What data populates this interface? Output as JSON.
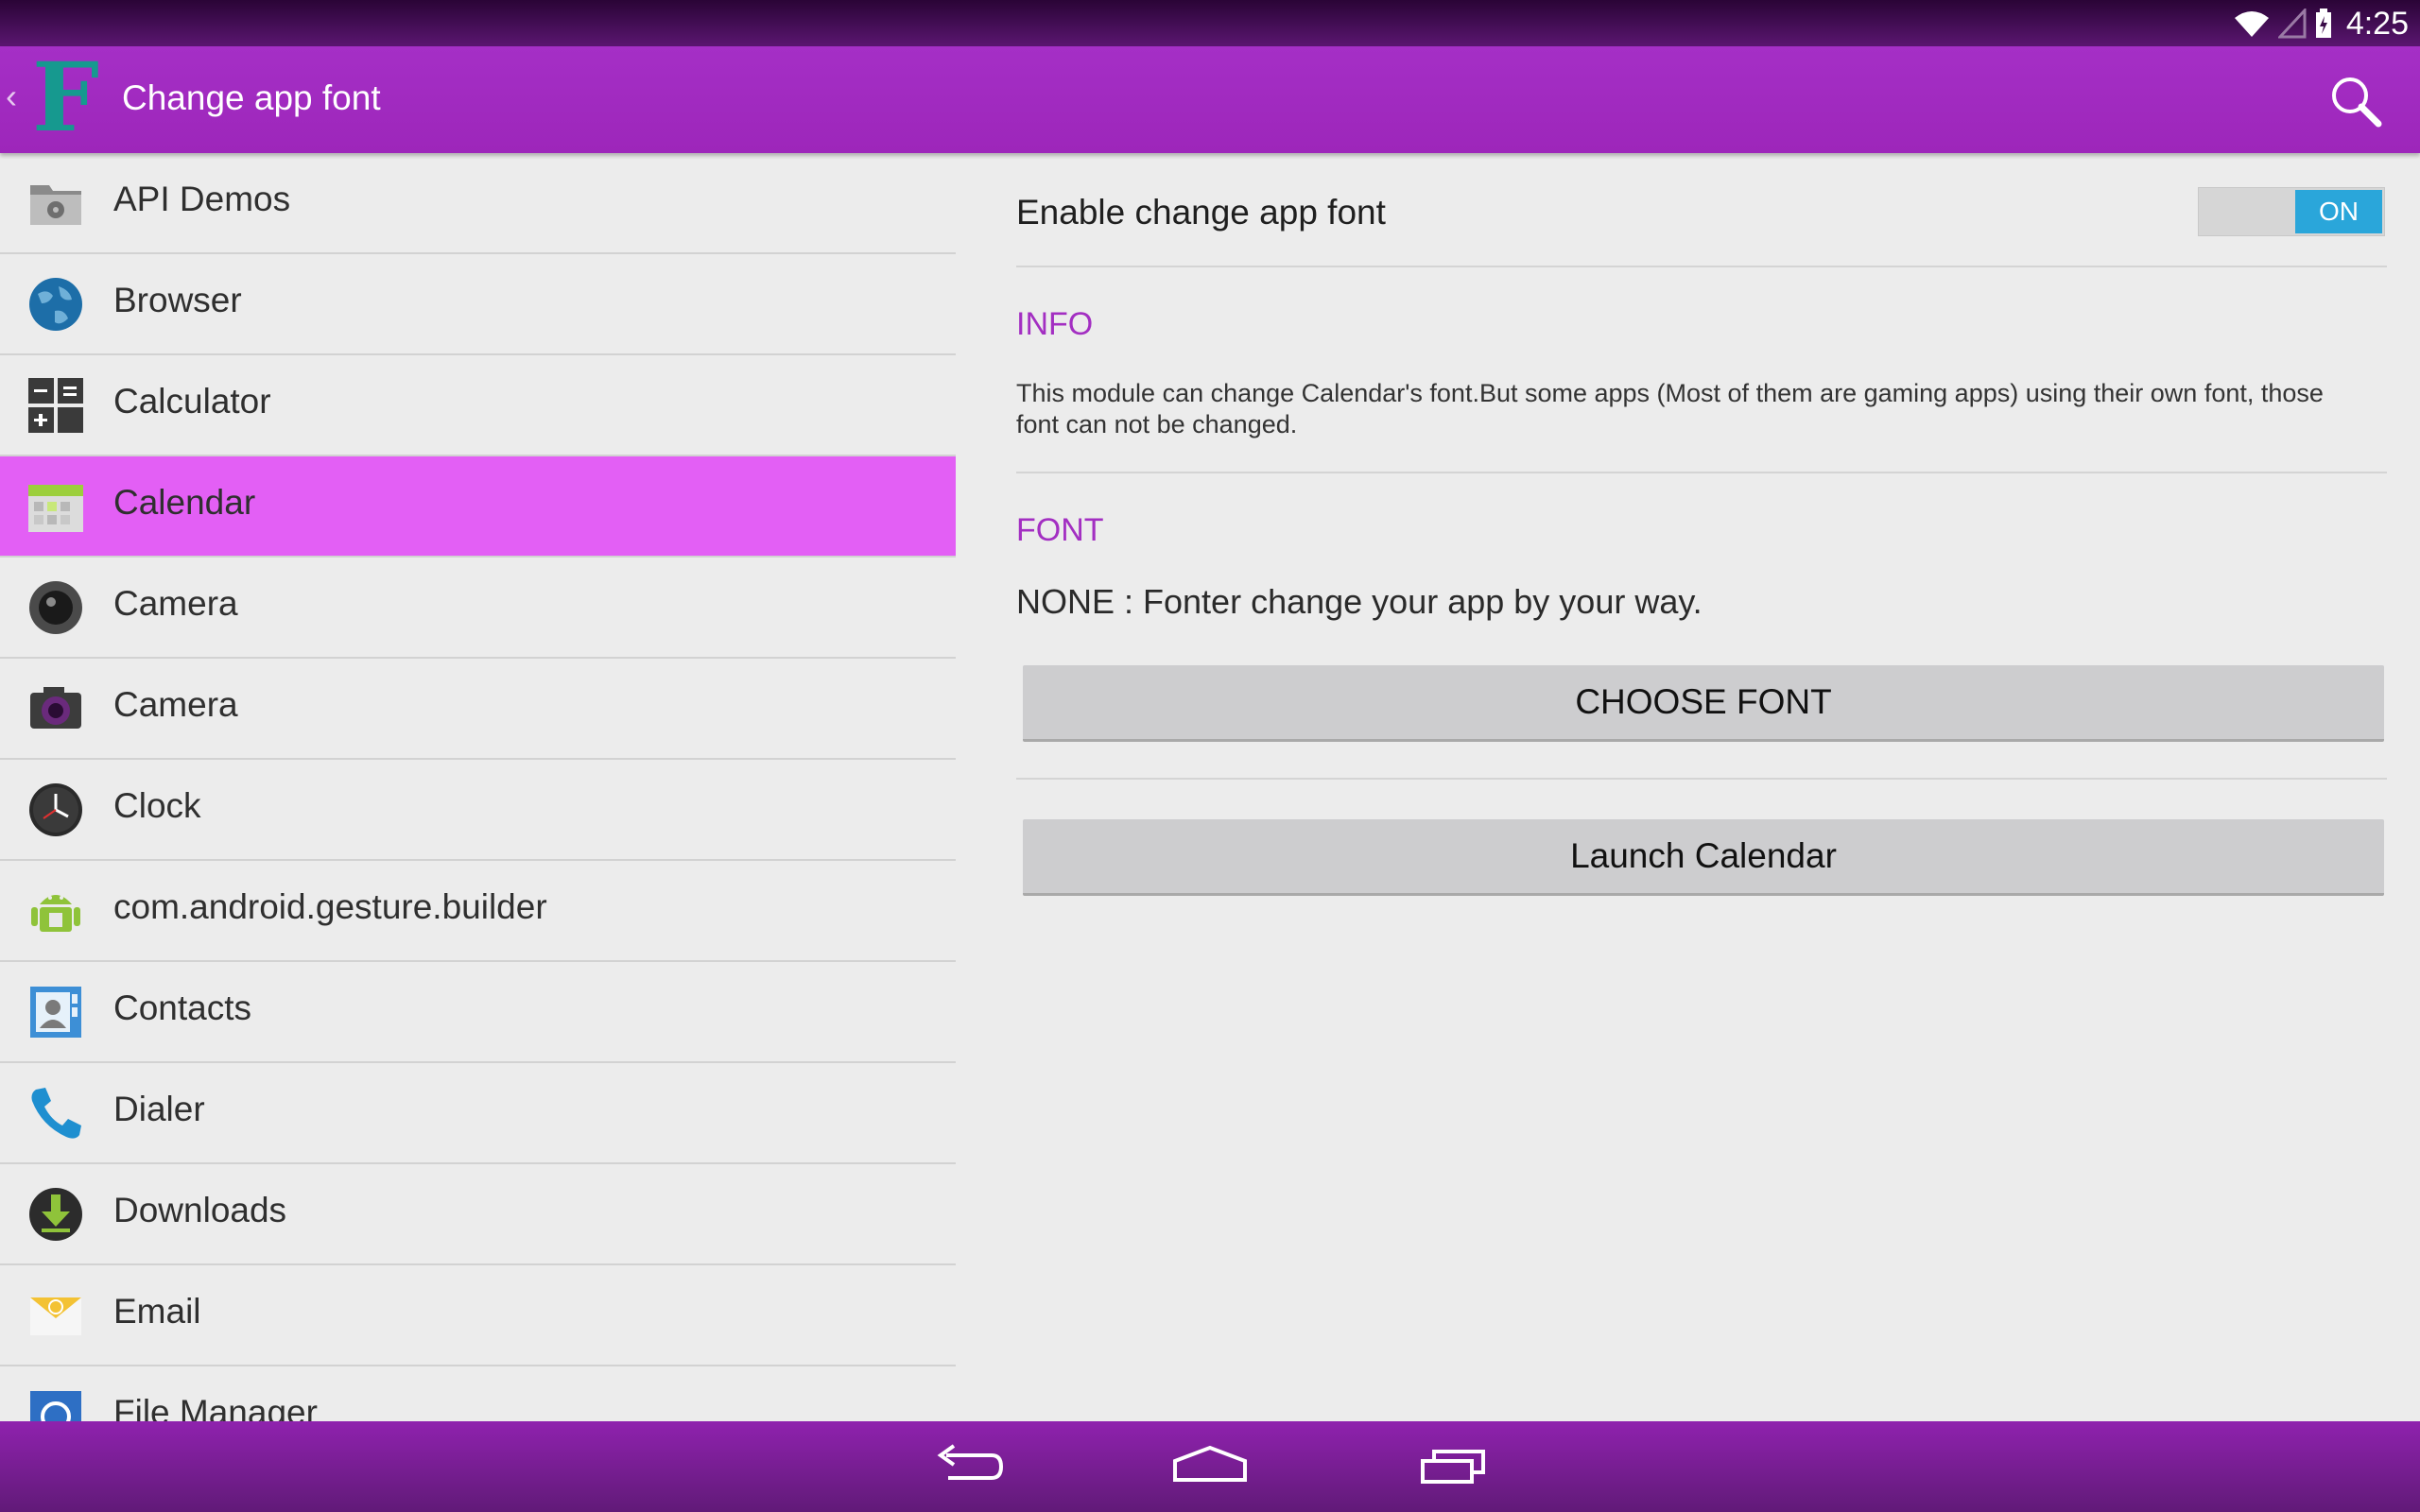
{
  "status_bar": {
    "time": "4:25"
  },
  "action_bar": {
    "logo_letter": "F",
    "title": "Change app font",
    "back_caret": "‹"
  },
  "app_list": [
    {
      "label": "API Demos",
      "icon": "folder-gear-icon"
    },
    {
      "label": "Browser",
      "icon": "globe-icon"
    },
    {
      "label": "Calculator",
      "icon": "calculator-icon"
    },
    {
      "label": "Calendar",
      "icon": "calendar-icon",
      "selected": true
    },
    {
      "label": "Camera",
      "icon": "camera-lens-icon"
    },
    {
      "label": "Camera",
      "icon": "camera-icon"
    },
    {
      "label": "Clock",
      "icon": "clock-icon"
    },
    {
      "label": "com.android.gesture.builder",
      "icon": "android-icon"
    },
    {
      "label": "Contacts",
      "icon": "contacts-icon"
    },
    {
      "label": "Dialer",
      "icon": "phone-icon"
    },
    {
      "label": "Downloads",
      "icon": "download-icon"
    },
    {
      "label": "Email",
      "icon": "email-icon"
    },
    {
      "label": "File Manager",
      "icon": "file-manager-icon"
    }
  ],
  "detail": {
    "enable_label": "Enable change app font",
    "toggle_state": "ON",
    "info_heading": "INFO",
    "info_text": "This module can change  Calendar's font.But some apps (Most of them are gaming apps) using their own font, those font can not be changed.",
    "font_heading": "FONT",
    "font_status": "NONE : Fonter change your app by your way.",
    "choose_font_label": "CHOOSE FONT",
    "launch_label": "Launch Calendar"
  },
  "colors": {
    "accent": "#a32fc2",
    "selected_row": "#e35ff5",
    "toggle_on": "#2aa6da"
  }
}
